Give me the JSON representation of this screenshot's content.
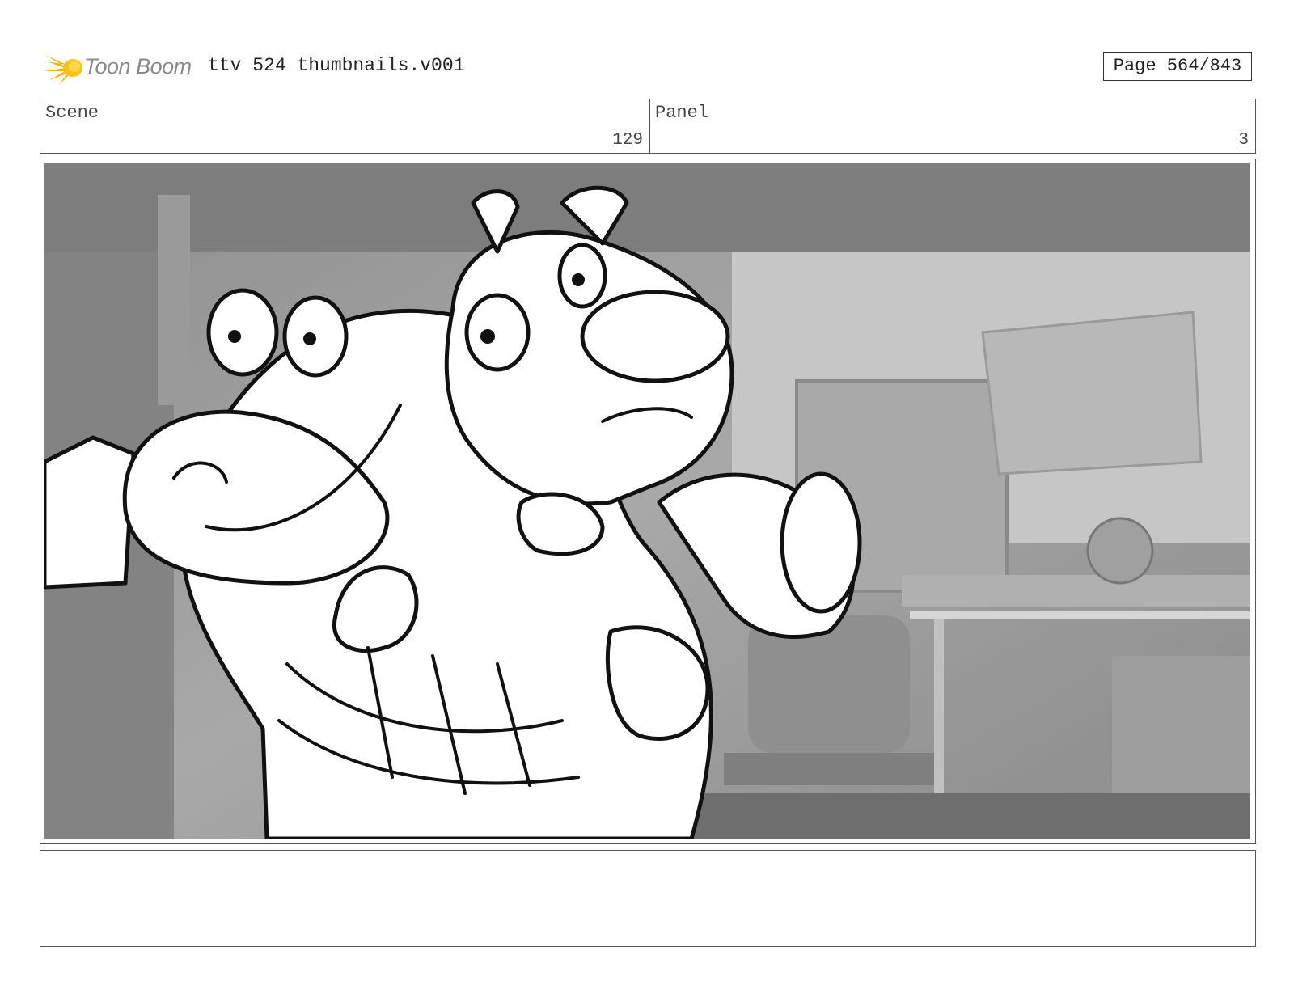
{
  "header": {
    "logo_text": "Toon Boom",
    "title": "ttv 524 thumbnails.v001",
    "page": "Page 564/843"
  },
  "info": {
    "scene_label": "Scene",
    "scene_value": "129",
    "panel_label": "Panel",
    "panel_value": "3"
  },
  "notes": {
    "text": ""
  },
  "colors": {
    "logo_accent": "#f5b400",
    "border": "#555555",
    "background_scene": "#9c9c9c"
  }
}
